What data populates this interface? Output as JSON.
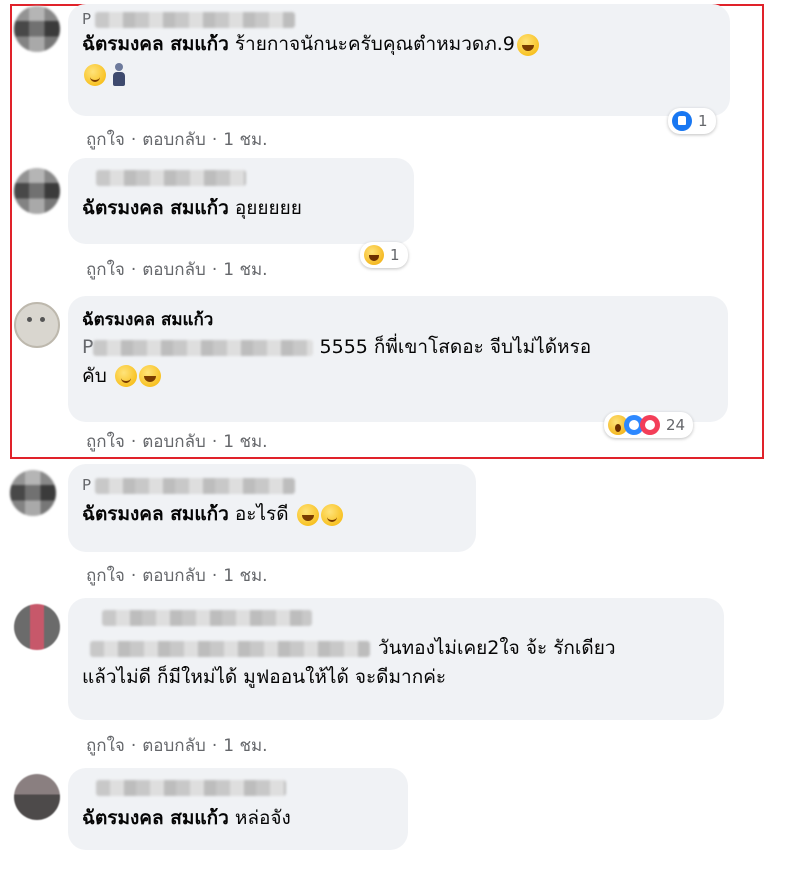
{
  "highlight_color": "#e0222a",
  "actions": {
    "like": "ถูกใจ",
    "dot": "·",
    "reply": "ตอบกลับ",
    "time": "1 ชม."
  },
  "comments": [
    {
      "name_prefix": "P",
      "mention": "ฉัตรมงคล สมแก้ว",
      "text": "ร้ายกาจนักนะครับคุณตำหมวดภ.9",
      "reaction_count": "1"
    },
    {
      "name_prefix": "",
      "mention": "ฉัตรมงคล สมแก้ว",
      "text": "อุยยยยย",
      "reaction_count": "1"
    },
    {
      "author": "ฉัตรมงคล สมแก้ว",
      "text_prefix": "P",
      "text": "5555 ก็พี่เขาโสดอะ จีบไม่ได้หรอ",
      "text_line2": "คับ",
      "reaction_count": "24"
    },
    {
      "name_prefix": "P",
      "mention": "ฉัตรมงคล สมแก้ว",
      "text": "อะไรดี"
    },
    {
      "text": "วันทองไม่เคย2ใจ จ้ะ รักเดียว",
      "text_line2": "แล้วไม่ดี ก็มีใหม่ได้ มูฟออนให้ได้ จะดีมากค่ะ"
    },
    {
      "mention": "ฉัตรมงคล สมแก้ว",
      "text": "หล่อจัง"
    }
  ]
}
